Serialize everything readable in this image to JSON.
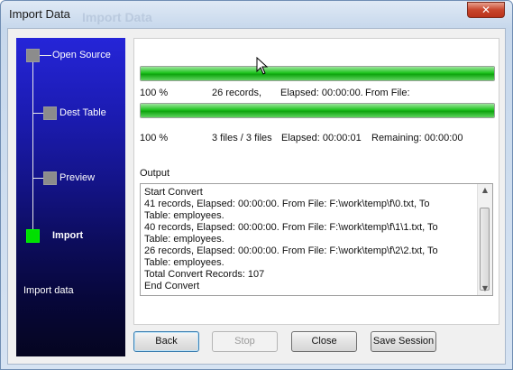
{
  "window": {
    "title": "Import Data",
    "ghost_title": "Import Data"
  },
  "steps": [
    {
      "label": "Open Source",
      "active": false
    },
    {
      "label": "Dest Table",
      "active": false
    },
    {
      "label": "Preview",
      "active": false
    },
    {
      "label": "Import",
      "active": true
    }
  ],
  "sidebar": {
    "caption": "Import data"
  },
  "progress1": {
    "value": 1.0,
    "percent": "100 %",
    "records": "26 records,",
    "elapsed": "Elapsed: 00:00:00.",
    "from_file": "From File:"
  },
  "progress2": {
    "value": 1.0,
    "percent": "100 %",
    "files": "3 files / 3 files",
    "elapsed": "Elapsed: 00:00:01",
    "remaining": "Remaining: 00:00:00"
  },
  "output": {
    "label": "Output",
    "lines": [
      "Start Convert",
      "41 records,    Elapsed: 00:00:00.    From File: F:\\work\\temp\\f\\0.txt,    To",
      "Table: employees.",
      "40 records,    Elapsed: 00:00:00.    From File: F:\\work\\temp\\f\\1\\1.txt,    To",
      "Table: employees.",
      "26 records,    Elapsed: 00:00:00.    From File: F:\\work\\temp\\f\\2\\2.txt,    To",
      "Table: employees.",
      "Total Convert Records: 107",
      "End Convert"
    ]
  },
  "buttons": {
    "back": "Back",
    "stop": "Stop",
    "close": "Close",
    "save_session": "Save Session"
  },
  "icons": {
    "close": "close-icon",
    "scroll_up": "scroll-up-icon",
    "scroll_down": "scroll-down-icon",
    "cursor": "mouse-cursor-icon"
  }
}
